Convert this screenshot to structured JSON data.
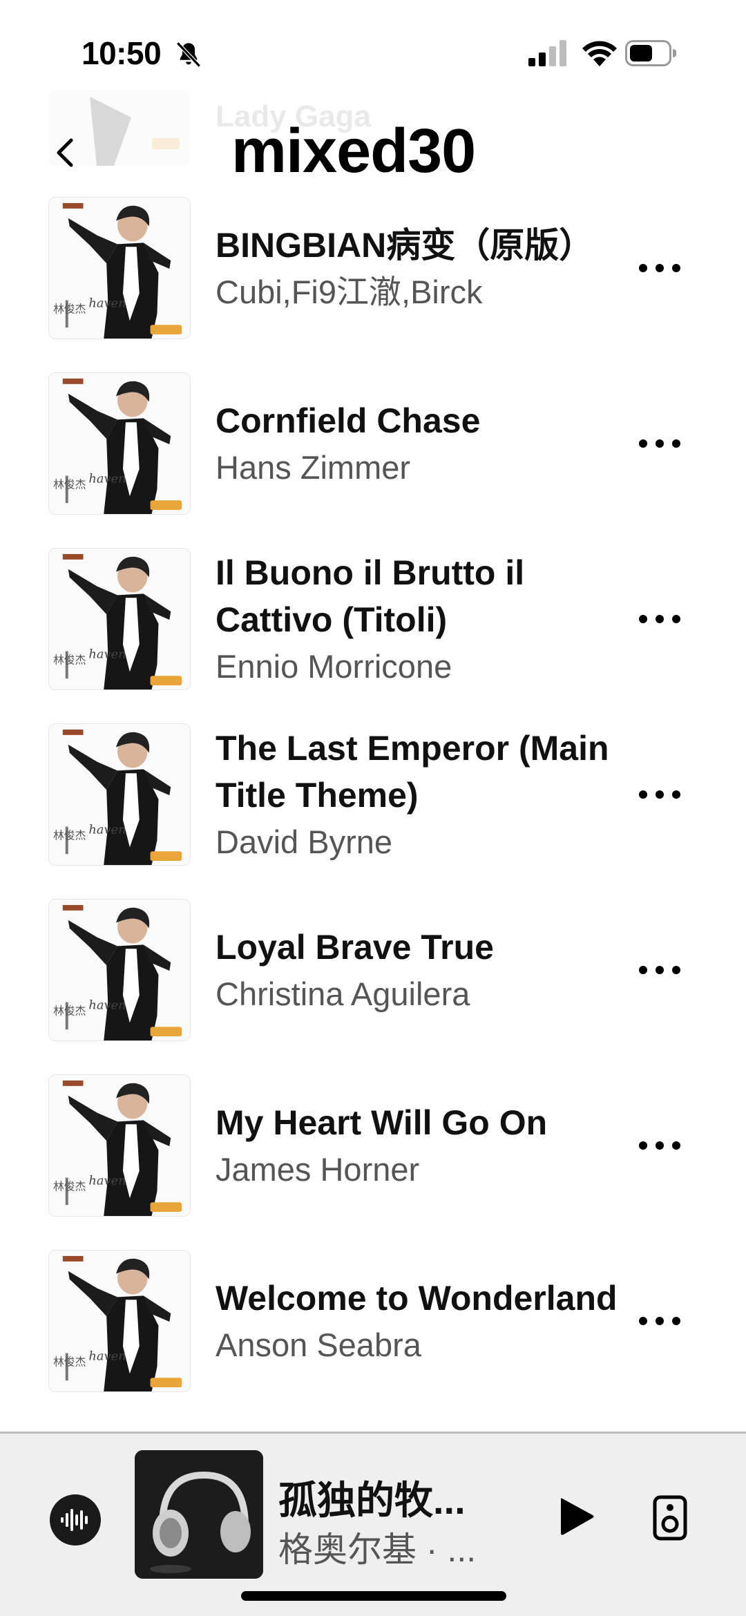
{
  "status_bar": {
    "time": "10:50"
  },
  "header": {
    "title": "mixed30",
    "peek_artist": "Lady Gaga"
  },
  "songs": [
    {
      "title": "BINGBIAN病变（原版）",
      "artist": "Cubi,Fi9江澈,Birck"
    },
    {
      "title": "Cornfield Chase",
      "artist": "Hans Zimmer"
    },
    {
      "title": "Il Buono il Brutto il Cattivo (Titoli)",
      "artist": "Ennio Morricone"
    },
    {
      "title": "The Last Emperor (Main Title Theme)",
      "artist": "David Byrne"
    },
    {
      "title": "Loyal Brave True",
      "artist": "Christina Aguilera"
    },
    {
      "title": "My Heart Will Go On",
      "artist": "James Horner"
    },
    {
      "title": "Welcome to Wonderland",
      "artist": "Anson Seabra"
    }
  ],
  "mini_player": {
    "title": "孤独的牧...",
    "artist": "格奥尔基 · ..."
  },
  "colors": {
    "text_primary": "#111111",
    "text_secondary": "#555555",
    "player_bg": "#efefef"
  }
}
